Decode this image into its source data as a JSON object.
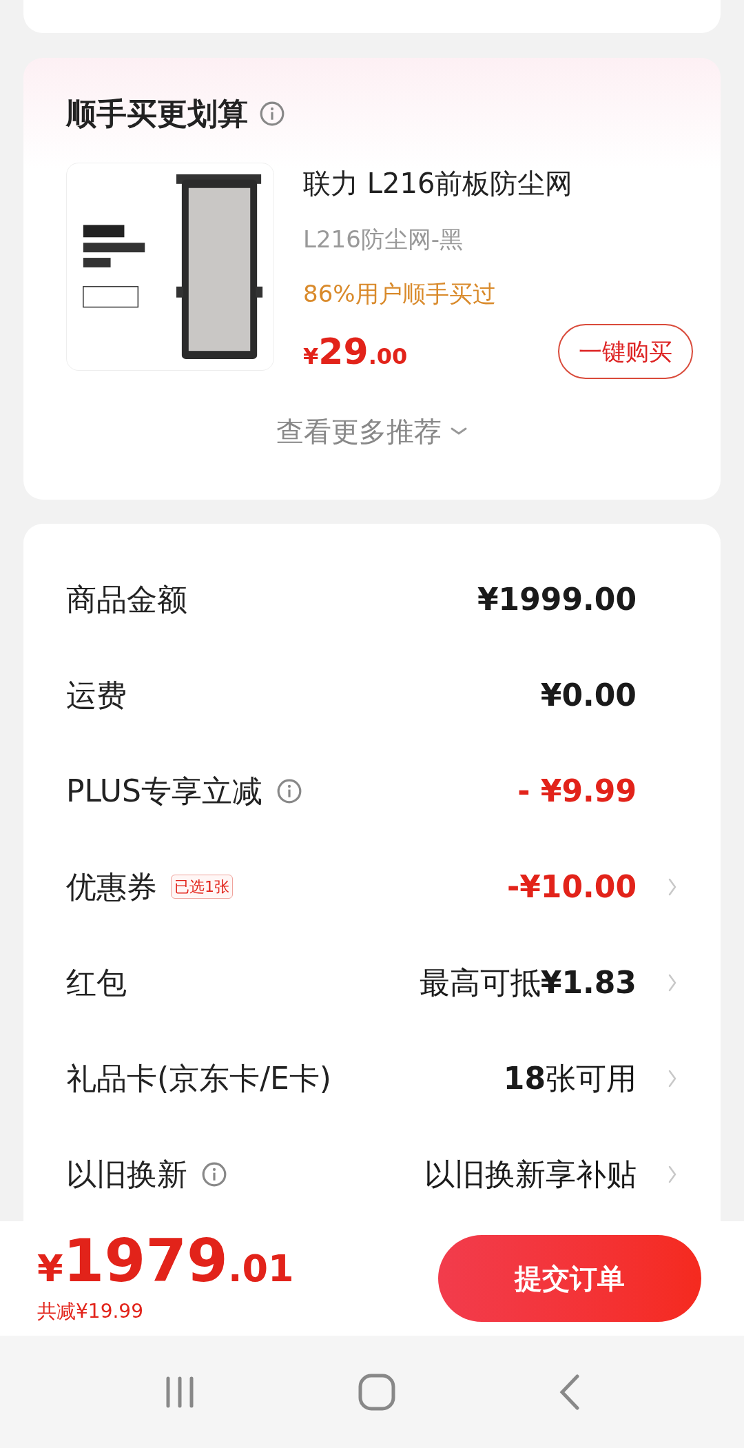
{
  "recommend": {
    "title": "顺手买更划算",
    "info": true,
    "product": {
      "name": "联力 L216前板防尘网",
      "variant": "L216防尘网-黑",
      "social": "86%用户顺手买过",
      "currency": "¥",
      "price_int": "29",
      "price_dec": ".00",
      "button": "一键购买"
    },
    "more": "查看更多推荐"
  },
  "summary": [
    {
      "label": "商品金额",
      "info": false,
      "value": "¥1999.00",
      "kind": "normal",
      "arrow": false
    },
    {
      "label": "运费",
      "info": false,
      "value": "¥0.00",
      "kind": "normal",
      "arrow": false
    },
    {
      "label": "PLUS专享立减",
      "info": true,
      "value": "- ¥9.99",
      "kind": "discount",
      "arrow": false
    },
    {
      "label": "优惠券",
      "info": false,
      "tag": "已选1张",
      "value": "-¥10.00",
      "kind": "discount",
      "arrow": true
    },
    {
      "label": "红包",
      "info": false,
      "value": "最高可抵**¥1.83**",
      "kind": "plain",
      "arrow": true
    },
    {
      "label": "礼品卡(京东卡/E卡)",
      "info": false,
      "value": "**18**张可用",
      "kind": "plain",
      "arrow": true
    },
    {
      "label": "以旧换新",
      "info": true,
      "value": "以旧换新享补贴",
      "kind": "plain",
      "arrow": true
    }
  ],
  "footer": {
    "currency": "¥",
    "total_int": "1979",
    "total_dec": ".01",
    "saved": "共减¥19.99",
    "submit": "提交订单"
  }
}
